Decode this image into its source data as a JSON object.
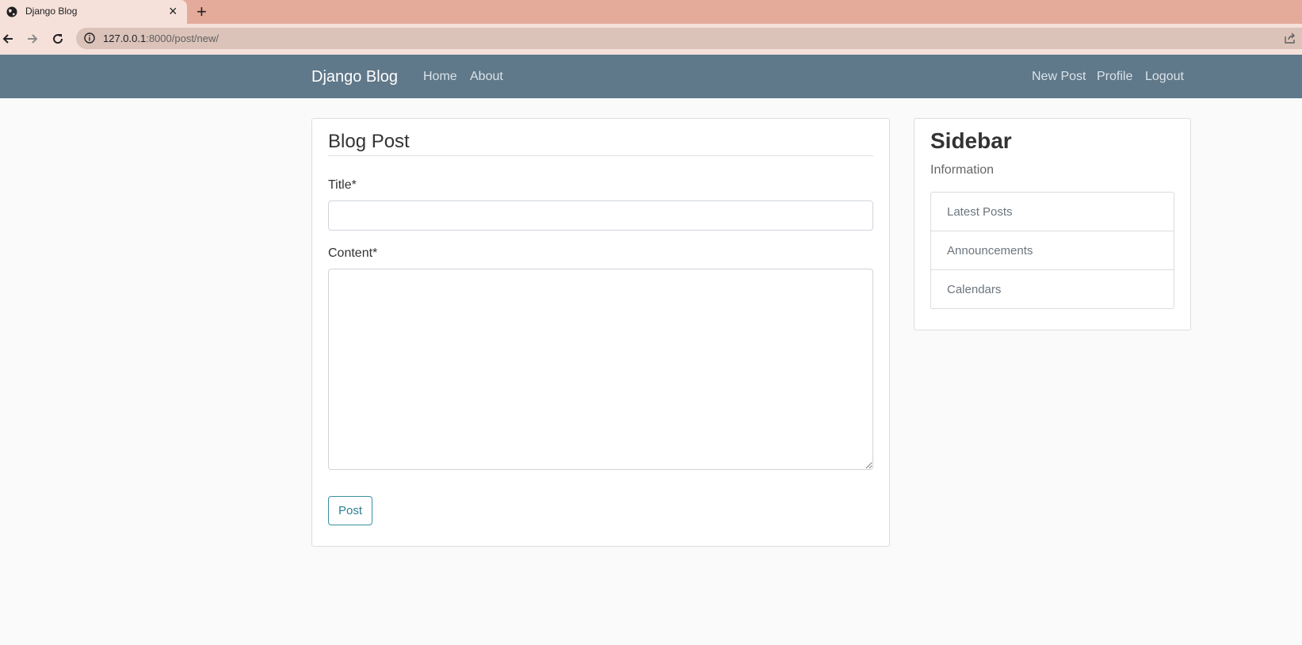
{
  "browser": {
    "tab_title": "Django Blog",
    "close_glyph": "×",
    "new_tab_glyph": "+",
    "url_host": "127.0.0.1",
    "url_rest": ":8000/post/new/"
  },
  "navbar": {
    "brand": "Django Blog",
    "left_links": [
      "Home",
      "About"
    ],
    "right_links": [
      "New Post",
      "Profile",
      "Logout"
    ],
    "background": "#5f788a"
  },
  "form": {
    "heading": "Blog Post",
    "title_label": "Title*",
    "title_value": "",
    "content_label": "Content*",
    "content_value": "",
    "submit_label": "Post",
    "accent": "#2d7f94"
  },
  "sidebar": {
    "title": "Sidebar",
    "subtitle": "Information",
    "items": [
      "Latest Posts",
      "Announcements",
      "Calendars"
    ]
  },
  "icons": {
    "tab_favicon": "globe-icon",
    "back": "arrow-left-icon",
    "forward": "arrow-right-icon",
    "reload": "reload-icon",
    "site_info": "info-icon",
    "share": "share-icon"
  }
}
